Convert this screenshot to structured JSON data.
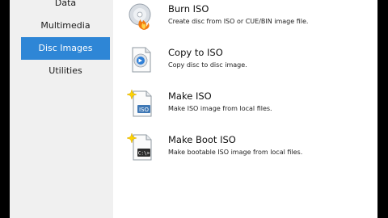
{
  "sidebar": {
    "items": [
      {
        "label": "Data"
      },
      {
        "label": "Multimedia"
      },
      {
        "label": "Disc Images",
        "active": true
      },
      {
        "label": "Utilities"
      }
    ]
  },
  "actions": [
    {
      "title": "Burn ISO",
      "description": "Create disc from ISO or CUE/BIN image file.",
      "icon": "disc-fire-icon"
    },
    {
      "title": "Copy to ISO",
      "description": "Copy disc to disc image.",
      "icon": "disc-copy-icon"
    },
    {
      "title": "Make ISO",
      "description": "Make ISO image from local files.",
      "icon": "iso-file-icon",
      "icon_text": "ISO"
    },
    {
      "title": "Make Boot ISO",
      "description": "Make bootable ISO image from local files.",
      "icon": "boot-iso-icon",
      "icon_text": "C:\\>"
    }
  ],
  "colors": {
    "accent": "#2e86d6",
    "sidebar_bg": "#f0f0f0",
    "content_bg": "#ffffff"
  }
}
